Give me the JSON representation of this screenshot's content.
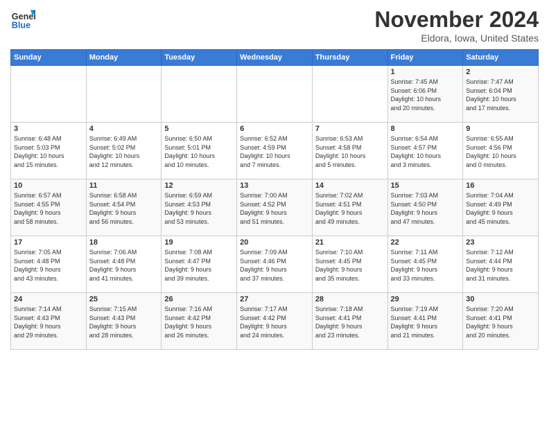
{
  "logo": {
    "line1": "General",
    "line2": "Blue"
  },
  "title": {
    "month_year": "November 2024",
    "location": "Eldora, Iowa, United States"
  },
  "weekdays": [
    "Sunday",
    "Monday",
    "Tuesday",
    "Wednesday",
    "Thursday",
    "Friday",
    "Saturday"
  ],
  "weeks": [
    [
      {
        "day": "",
        "info": ""
      },
      {
        "day": "",
        "info": ""
      },
      {
        "day": "",
        "info": ""
      },
      {
        "day": "",
        "info": ""
      },
      {
        "day": "",
        "info": ""
      },
      {
        "day": "1",
        "info": "Sunrise: 7:45 AM\nSunset: 6:06 PM\nDaylight: 10 hours\nand 20 minutes."
      },
      {
        "day": "2",
        "info": "Sunrise: 7:47 AM\nSunset: 6:04 PM\nDaylight: 10 hours\nand 17 minutes."
      }
    ],
    [
      {
        "day": "3",
        "info": "Sunrise: 6:48 AM\nSunset: 5:03 PM\nDaylight: 10 hours\nand 15 minutes."
      },
      {
        "day": "4",
        "info": "Sunrise: 6:49 AM\nSunset: 5:02 PM\nDaylight: 10 hours\nand 12 minutes."
      },
      {
        "day": "5",
        "info": "Sunrise: 6:50 AM\nSunset: 5:01 PM\nDaylight: 10 hours\nand 10 minutes."
      },
      {
        "day": "6",
        "info": "Sunrise: 6:52 AM\nSunset: 4:59 PM\nDaylight: 10 hours\nand 7 minutes."
      },
      {
        "day": "7",
        "info": "Sunrise: 6:53 AM\nSunset: 4:58 PM\nDaylight: 10 hours\nand 5 minutes."
      },
      {
        "day": "8",
        "info": "Sunrise: 6:54 AM\nSunset: 4:57 PM\nDaylight: 10 hours\nand 3 minutes."
      },
      {
        "day": "9",
        "info": "Sunrise: 6:55 AM\nSunset: 4:56 PM\nDaylight: 10 hours\nand 0 minutes."
      }
    ],
    [
      {
        "day": "10",
        "info": "Sunrise: 6:57 AM\nSunset: 4:55 PM\nDaylight: 9 hours\nand 58 minutes."
      },
      {
        "day": "11",
        "info": "Sunrise: 6:58 AM\nSunset: 4:54 PM\nDaylight: 9 hours\nand 56 minutes."
      },
      {
        "day": "12",
        "info": "Sunrise: 6:59 AM\nSunset: 4:53 PM\nDaylight: 9 hours\nand 53 minutes."
      },
      {
        "day": "13",
        "info": "Sunrise: 7:00 AM\nSunset: 4:52 PM\nDaylight: 9 hours\nand 51 minutes."
      },
      {
        "day": "14",
        "info": "Sunrise: 7:02 AM\nSunset: 4:51 PM\nDaylight: 9 hours\nand 49 minutes."
      },
      {
        "day": "15",
        "info": "Sunrise: 7:03 AM\nSunset: 4:50 PM\nDaylight: 9 hours\nand 47 minutes."
      },
      {
        "day": "16",
        "info": "Sunrise: 7:04 AM\nSunset: 4:49 PM\nDaylight: 9 hours\nand 45 minutes."
      }
    ],
    [
      {
        "day": "17",
        "info": "Sunrise: 7:05 AM\nSunset: 4:48 PM\nDaylight: 9 hours\nand 43 minutes."
      },
      {
        "day": "18",
        "info": "Sunrise: 7:06 AM\nSunset: 4:48 PM\nDaylight: 9 hours\nand 41 minutes."
      },
      {
        "day": "19",
        "info": "Sunrise: 7:08 AM\nSunset: 4:47 PM\nDaylight: 9 hours\nand 39 minutes."
      },
      {
        "day": "20",
        "info": "Sunrise: 7:09 AM\nSunset: 4:46 PM\nDaylight: 9 hours\nand 37 minutes."
      },
      {
        "day": "21",
        "info": "Sunrise: 7:10 AM\nSunset: 4:45 PM\nDaylight: 9 hours\nand 35 minutes."
      },
      {
        "day": "22",
        "info": "Sunrise: 7:11 AM\nSunset: 4:45 PM\nDaylight: 9 hours\nand 33 minutes."
      },
      {
        "day": "23",
        "info": "Sunrise: 7:12 AM\nSunset: 4:44 PM\nDaylight: 9 hours\nand 31 minutes."
      }
    ],
    [
      {
        "day": "24",
        "info": "Sunrise: 7:14 AM\nSunset: 4:43 PM\nDaylight: 9 hours\nand 29 minutes."
      },
      {
        "day": "25",
        "info": "Sunrise: 7:15 AM\nSunset: 4:43 PM\nDaylight: 9 hours\nand 28 minutes."
      },
      {
        "day": "26",
        "info": "Sunrise: 7:16 AM\nSunset: 4:42 PM\nDaylight: 9 hours\nand 26 minutes."
      },
      {
        "day": "27",
        "info": "Sunrise: 7:17 AM\nSunset: 4:42 PM\nDaylight: 9 hours\nand 24 minutes."
      },
      {
        "day": "28",
        "info": "Sunrise: 7:18 AM\nSunset: 4:41 PM\nDaylight: 9 hours\nand 23 minutes."
      },
      {
        "day": "29",
        "info": "Sunrise: 7:19 AM\nSunset: 4:41 PM\nDaylight: 9 hours\nand 21 minutes."
      },
      {
        "day": "30",
        "info": "Sunrise: 7:20 AM\nSunset: 4:41 PM\nDaylight: 9 hours\nand 20 minutes."
      }
    ]
  ]
}
